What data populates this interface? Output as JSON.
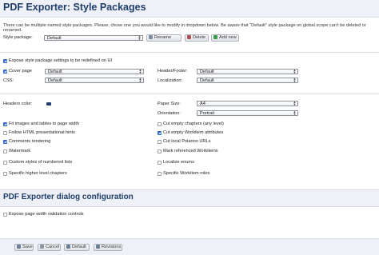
{
  "header": {
    "title": "PDF Exporter: Style Packages"
  },
  "note": "There can be multiple named style packages. Please, chose one you would like to modify in dropdown below. Be aware that \"Default\" style package on global scope can't be deleted or renamed.",
  "style_package": {
    "label": "Style package:",
    "value": "Default",
    "rename": "Rename",
    "delete": "Delete",
    "add_new": "Add new"
  },
  "expose": {
    "label": "Expose style package settings to be redefined on UI",
    "checked": true
  },
  "cover_page": {
    "label": "Cover page",
    "value": "Default",
    "checked": true
  },
  "header_footer": {
    "label": "Header/Footer:",
    "value": "Default"
  },
  "css": {
    "label": "CSS:",
    "value": "Default"
  },
  "localization": {
    "label": "Localization:",
    "value": "Default"
  },
  "headers_color": {
    "label": "Headers color:",
    "color": "#1f3d6b"
  },
  "paper_size": {
    "label": "Paper Size:",
    "value": "A4"
  },
  "orientation": {
    "label": "Orientation:",
    "value": "Portrait"
  },
  "left_options": [
    {
      "label": "Fit images and tables to page width",
      "checked": true
    },
    {
      "label": "Follow HTML presentational hints",
      "checked": false
    },
    {
      "label": "Comments rendering",
      "checked": true
    },
    {
      "label": "Watermark",
      "checked": false
    },
    {
      "label": "Custom styles of numbered lists",
      "checked": false
    },
    {
      "label": "Specific higher level chapters",
      "checked": false
    }
  ],
  "right_options": [
    {
      "label": "Cut empty chapters (any level)",
      "checked": false
    },
    {
      "label": "Cut empty Workitem attributes",
      "checked": true
    },
    {
      "label": "Cut local Polarion URLs",
      "checked": false
    },
    {
      "label": "Mark referenced Workitems",
      "checked": false
    },
    {
      "label": "Localize enums",
      "checked": false
    },
    {
      "label": "Specific Workitem roles",
      "checked": false
    }
  ],
  "dialog_section": {
    "title": "PDF Exporter dialog configuration"
  },
  "page_width_validation": {
    "label": "Expose page width validation controls",
    "checked": false
  },
  "footer": {
    "save": "Save",
    "cancel": "Cancel",
    "default": "Default",
    "revisions": "Revisions"
  }
}
